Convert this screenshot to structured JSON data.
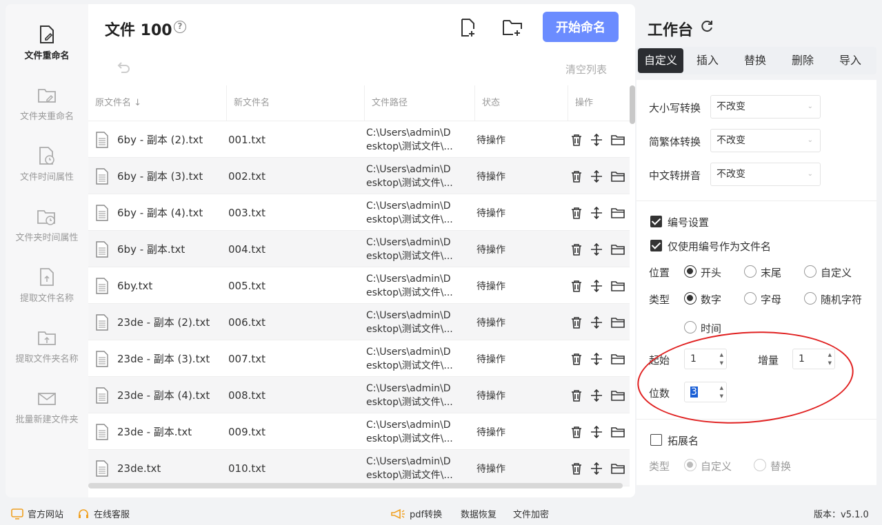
{
  "sidebar": {
    "items": [
      {
        "label": "文件重命名",
        "icon": "file-rename-icon",
        "active": true
      },
      {
        "label": "文件夹重命名",
        "icon": "folder-rename-icon"
      },
      {
        "label": "文件时间属性",
        "icon": "file-time-icon"
      },
      {
        "label": "文件夹时间属性",
        "icon": "folder-time-icon"
      },
      {
        "label": "提取文件名称",
        "icon": "extract-file-name-icon"
      },
      {
        "label": "提取文件夹名称",
        "icon": "extract-folder-name-icon"
      },
      {
        "label": "批量新建文件夹",
        "icon": "batch-new-folder-icon"
      }
    ]
  },
  "main": {
    "title": "文件 100",
    "help": "?",
    "start_button": "开始命名",
    "clear_list": "清空列表",
    "columns": [
      "原文件名",
      "新文件名",
      "文件路径",
      "状态",
      "操作"
    ],
    "rows": [
      {
        "original": "6by - 副本 (2).txt",
        "new": "001.txt",
        "path1": "C:\\Users\\admin\\D",
        "path2": "esktop\\测试文件\\...",
        "status": "待操作"
      },
      {
        "original": "6by - 副本 (3).txt",
        "new": "002.txt",
        "path1": "C:\\Users\\admin\\D",
        "path2": "esktop\\测试文件\\...",
        "status": "待操作"
      },
      {
        "original": "6by - 副本 (4).txt",
        "new": "003.txt",
        "path1": "C:\\Users\\admin\\D",
        "path2": "esktop\\测试文件\\...",
        "status": "待操作"
      },
      {
        "original": "6by - 副本.txt",
        "new": "004.txt",
        "path1": "C:\\Users\\admin\\D",
        "path2": "esktop\\测试文件\\...",
        "status": "待操作"
      },
      {
        "original": "6by.txt",
        "new": "005.txt",
        "path1": "C:\\Users\\admin\\D",
        "path2": "esktop\\测试文件\\...",
        "status": "待操作"
      },
      {
        "original": "23de - 副本 (2).txt",
        "new": "006.txt",
        "path1": "C:\\Users\\admin\\D",
        "path2": "esktop\\测试文件\\...",
        "status": "待操作"
      },
      {
        "original": "23de - 副本 (3).txt",
        "new": "007.txt",
        "path1": "C:\\Users\\admin\\D",
        "path2": "esktop\\测试文件\\...",
        "status": "待操作"
      },
      {
        "original": "23de - 副本 (4).txt",
        "new": "008.txt",
        "path1": "C:\\Users\\admin\\D",
        "path2": "esktop\\测试文件\\...",
        "status": "待操作"
      },
      {
        "original": "23de - 副本.txt",
        "new": "009.txt",
        "path1": "C:\\Users\\admin\\D",
        "path2": "esktop\\测试文件\\...",
        "status": "待操作"
      },
      {
        "original": "23de.txt",
        "new": "010.txt",
        "path1": "C:\\Users\\admin\\D",
        "path2": "esktop\\测试文件\\...",
        "status": "待操作"
      }
    ]
  },
  "workbench": {
    "title": "工作台",
    "tabs": [
      "自定义",
      "插入",
      "替换",
      "删除",
      "导入"
    ],
    "active_tab": "自定义",
    "case_label": "大小写转换",
    "case_value": "不改变",
    "trad_label": "简繁体转换",
    "trad_value": "不改变",
    "pinyin_label": "中文转拼音",
    "pinyin_value": "不改变",
    "numbering_label": "编号设置",
    "numbering_checked": true,
    "only_number_label": "仅使用编号作为文件名",
    "only_number_checked": true,
    "position_label": "位置",
    "position_options": [
      "开头",
      "末尾",
      "自定义"
    ],
    "position_selected": "开头",
    "type_label": "类型",
    "type_options": [
      "数字",
      "字母",
      "随机字符",
      "时间"
    ],
    "type_selected": "数字",
    "start_label": "起始",
    "start_value": "1",
    "increment_label": "增量",
    "increment_value": "1",
    "digits_label": "位数",
    "digits_value": "3",
    "ext_label": "拓展名",
    "ext_checked": false,
    "ext_type_label": "类型",
    "ext_type_options": [
      "自定义",
      "替换"
    ],
    "ext_type_selected": "自定义"
  },
  "footer": {
    "website": "官方网站",
    "support": "在线客服",
    "pdf": "pdf转换",
    "recovery": "数据恢复",
    "encrypt": "文件加密",
    "version": "版本：v5.1.0"
  },
  "colors": {
    "accent": "#6b8cff",
    "annotation": "#e02020",
    "tab_active": "#2b2d31"
  }
}
